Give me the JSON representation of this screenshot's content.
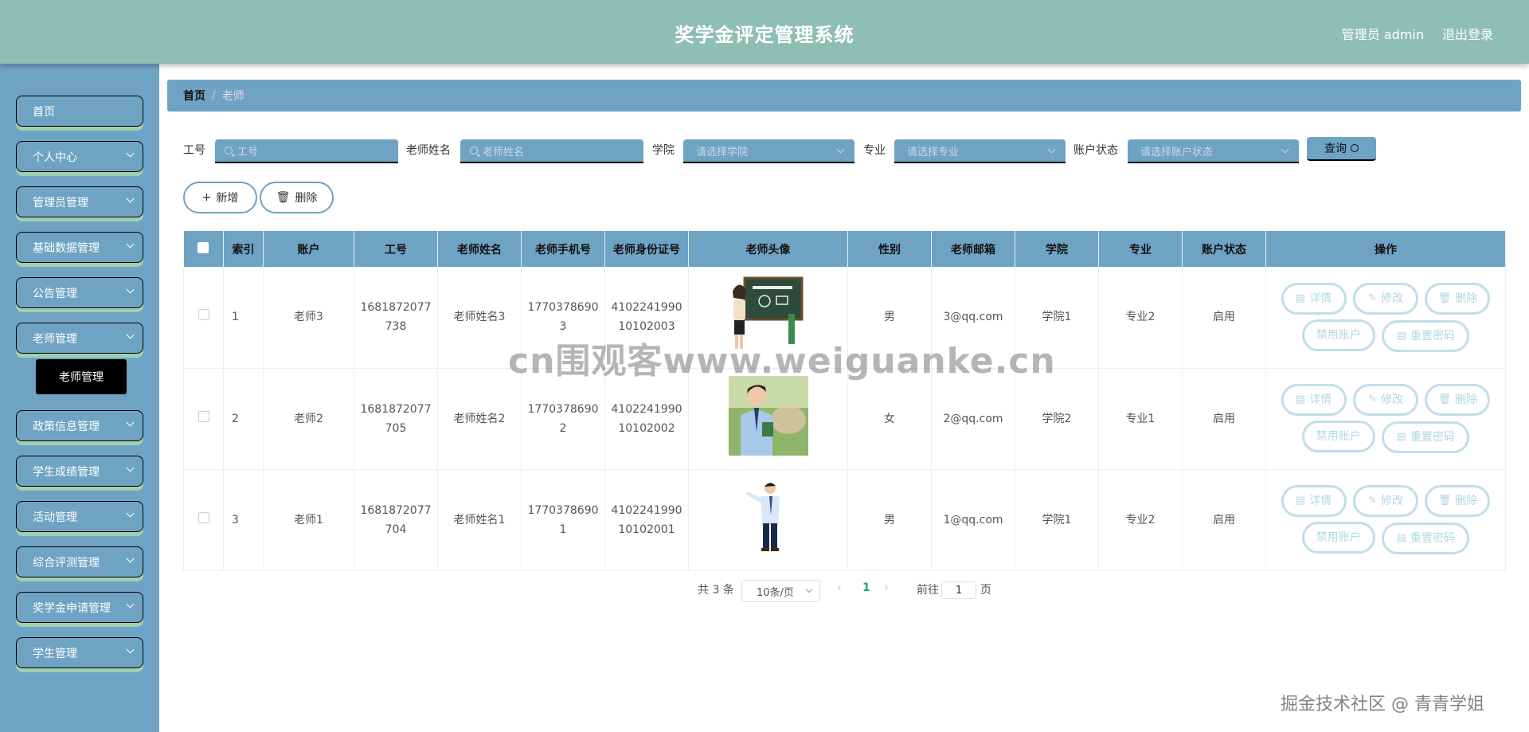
{
  "header": {
    "title": "奖学金评定管理系统",
    "user": "管理员 admin",
    "logout": "退出登录"
  },
  "sidebar": {
    "items": [
      {
        "label": "首页",
        "has_children": false
      },
      {
        "label": "个人中心",
        "has_children": true
      },
      {
        "label": "管理员管理",
        "has_children": true
      },
      {
        "label": "基础数据管理",
        "has_children": true
      },
      {
        "label": "公告管理",
        "has_children": true
      },
      {
        "label": "老师管理",
        "has_children": true
      },
      {
        "label": "政策信息管理",
        "has_children": true
      },
      {
        "label": "学生成绩管理",
        "has_children": true
      },
      {
        "label": "活动管理",
        "has_children": true
      },
      {
        "label": "综合评测管理",
        "has_children": true
      },
      {
        "label": "奖学金申请管理",
        "has_children": true
      },
      {
        "label": "学生管理",
        "has_children": true
      }
    ],
    "active_submenu": "老师管理"
  },
  "breadcrumb": {
    "home": "首页",
    "separator": "/",
    "current": "老师"
  },
  "search": {
    "gonghao_label": "工号",
    "gonghao_placeholder": "工号",
    "name_label": "老师姓名",
    "name_placeholder": "老师姓名",
    "college_label": "学院",
    "college_placeholder": "请选择学院",
    "major_label": "专业",
    "major_placeholder": "请选择专业",
    "status_label": "账户状态",
    "status_placeholder": "请选择账户状态",
    "query_label": "查询"
  },
  "toolbar": {
    "add_label": "新增",
    "delete_label": "删除"
  },
  "table": {
    "headers": [
      "",
      "索引",
      "账户",
      "工号",
      "老师姓名",
      "老师手机号",
      "老师身份证号",
      "老师头像",
      "性别",
      "老师邮箱",
      "学院",
      "专业",
      "账户状态",
      "操作"
    ],
    "rows": [
      {
        "index": "1",
        "account": "老师3",
        "gonghao_1": "1681872077",
        "gonghao_2": "738",
        "name": "老师姓名3",
        "phone_1": "1770378690",
        "phone_2": "3",
        "id_1": "4102241990",
        "id_2": "10102003",
        "gender": "男",
        "email": "3@qq.com",
        "college": "学院1",
        "major": "专业2",
        "status": "启用"
      },
      {
        "index": "2",
        "account": "老师2",
        "gonghao_1": "1681872077",
        "gonghao_2": "705",
        "name": "老师姓名2",
        "phone_1": "1770378690",
        "phone_2": "2",
        "id_1": "4102241990",
        "id_2": "10102002",
        "gender": "女",
        "email": "2@qq.com",
        "college": "学院2",
        "major": "专业1",
        "status": "启用"
      },
      {
        "index": "3",
        "account": "老师1",
        "gonghao_1": "1681872077",
        "gonghao_2": "704",
        "name": "老师姓名1",
        "phone_1": "1770378690",
        "phone_2": "1",
        "id_1": "4102241990",
        "id_2": "10102001",
        "gender": "男",
        "email": "1@qq.com",
        "college": "学院1",
        "major": "专业2",
        "status": "启用"
      }
    ],
    "actions": {
      "detail": "详情",
      "edit": "修改",
      "delete": "删除",
      "disable": "禁用账户",
      "reset": "重置密码"
    }
  },
  "pagination": {
    "total": "共 3 条",
    "page_size": "10条/页",
    "current_page": "1",
    "goto_label": "前往",
    "goto_value": "1",
    "page_unit": "页"
  },
  "watermarks": {
    "center": "cn围观客www.weiguanke.cn",
    "corner": "掘金技术社区 @ 青青学姐"
  },
  "colors": {
    "header": "#8fbfb2",
    "sidebar": "#6fa3c4",
    "menu_shadow": "#9fd0b0",
    "accent": "#6fa3c4",
    "action_border": "#bfdfe8"
  }
}
